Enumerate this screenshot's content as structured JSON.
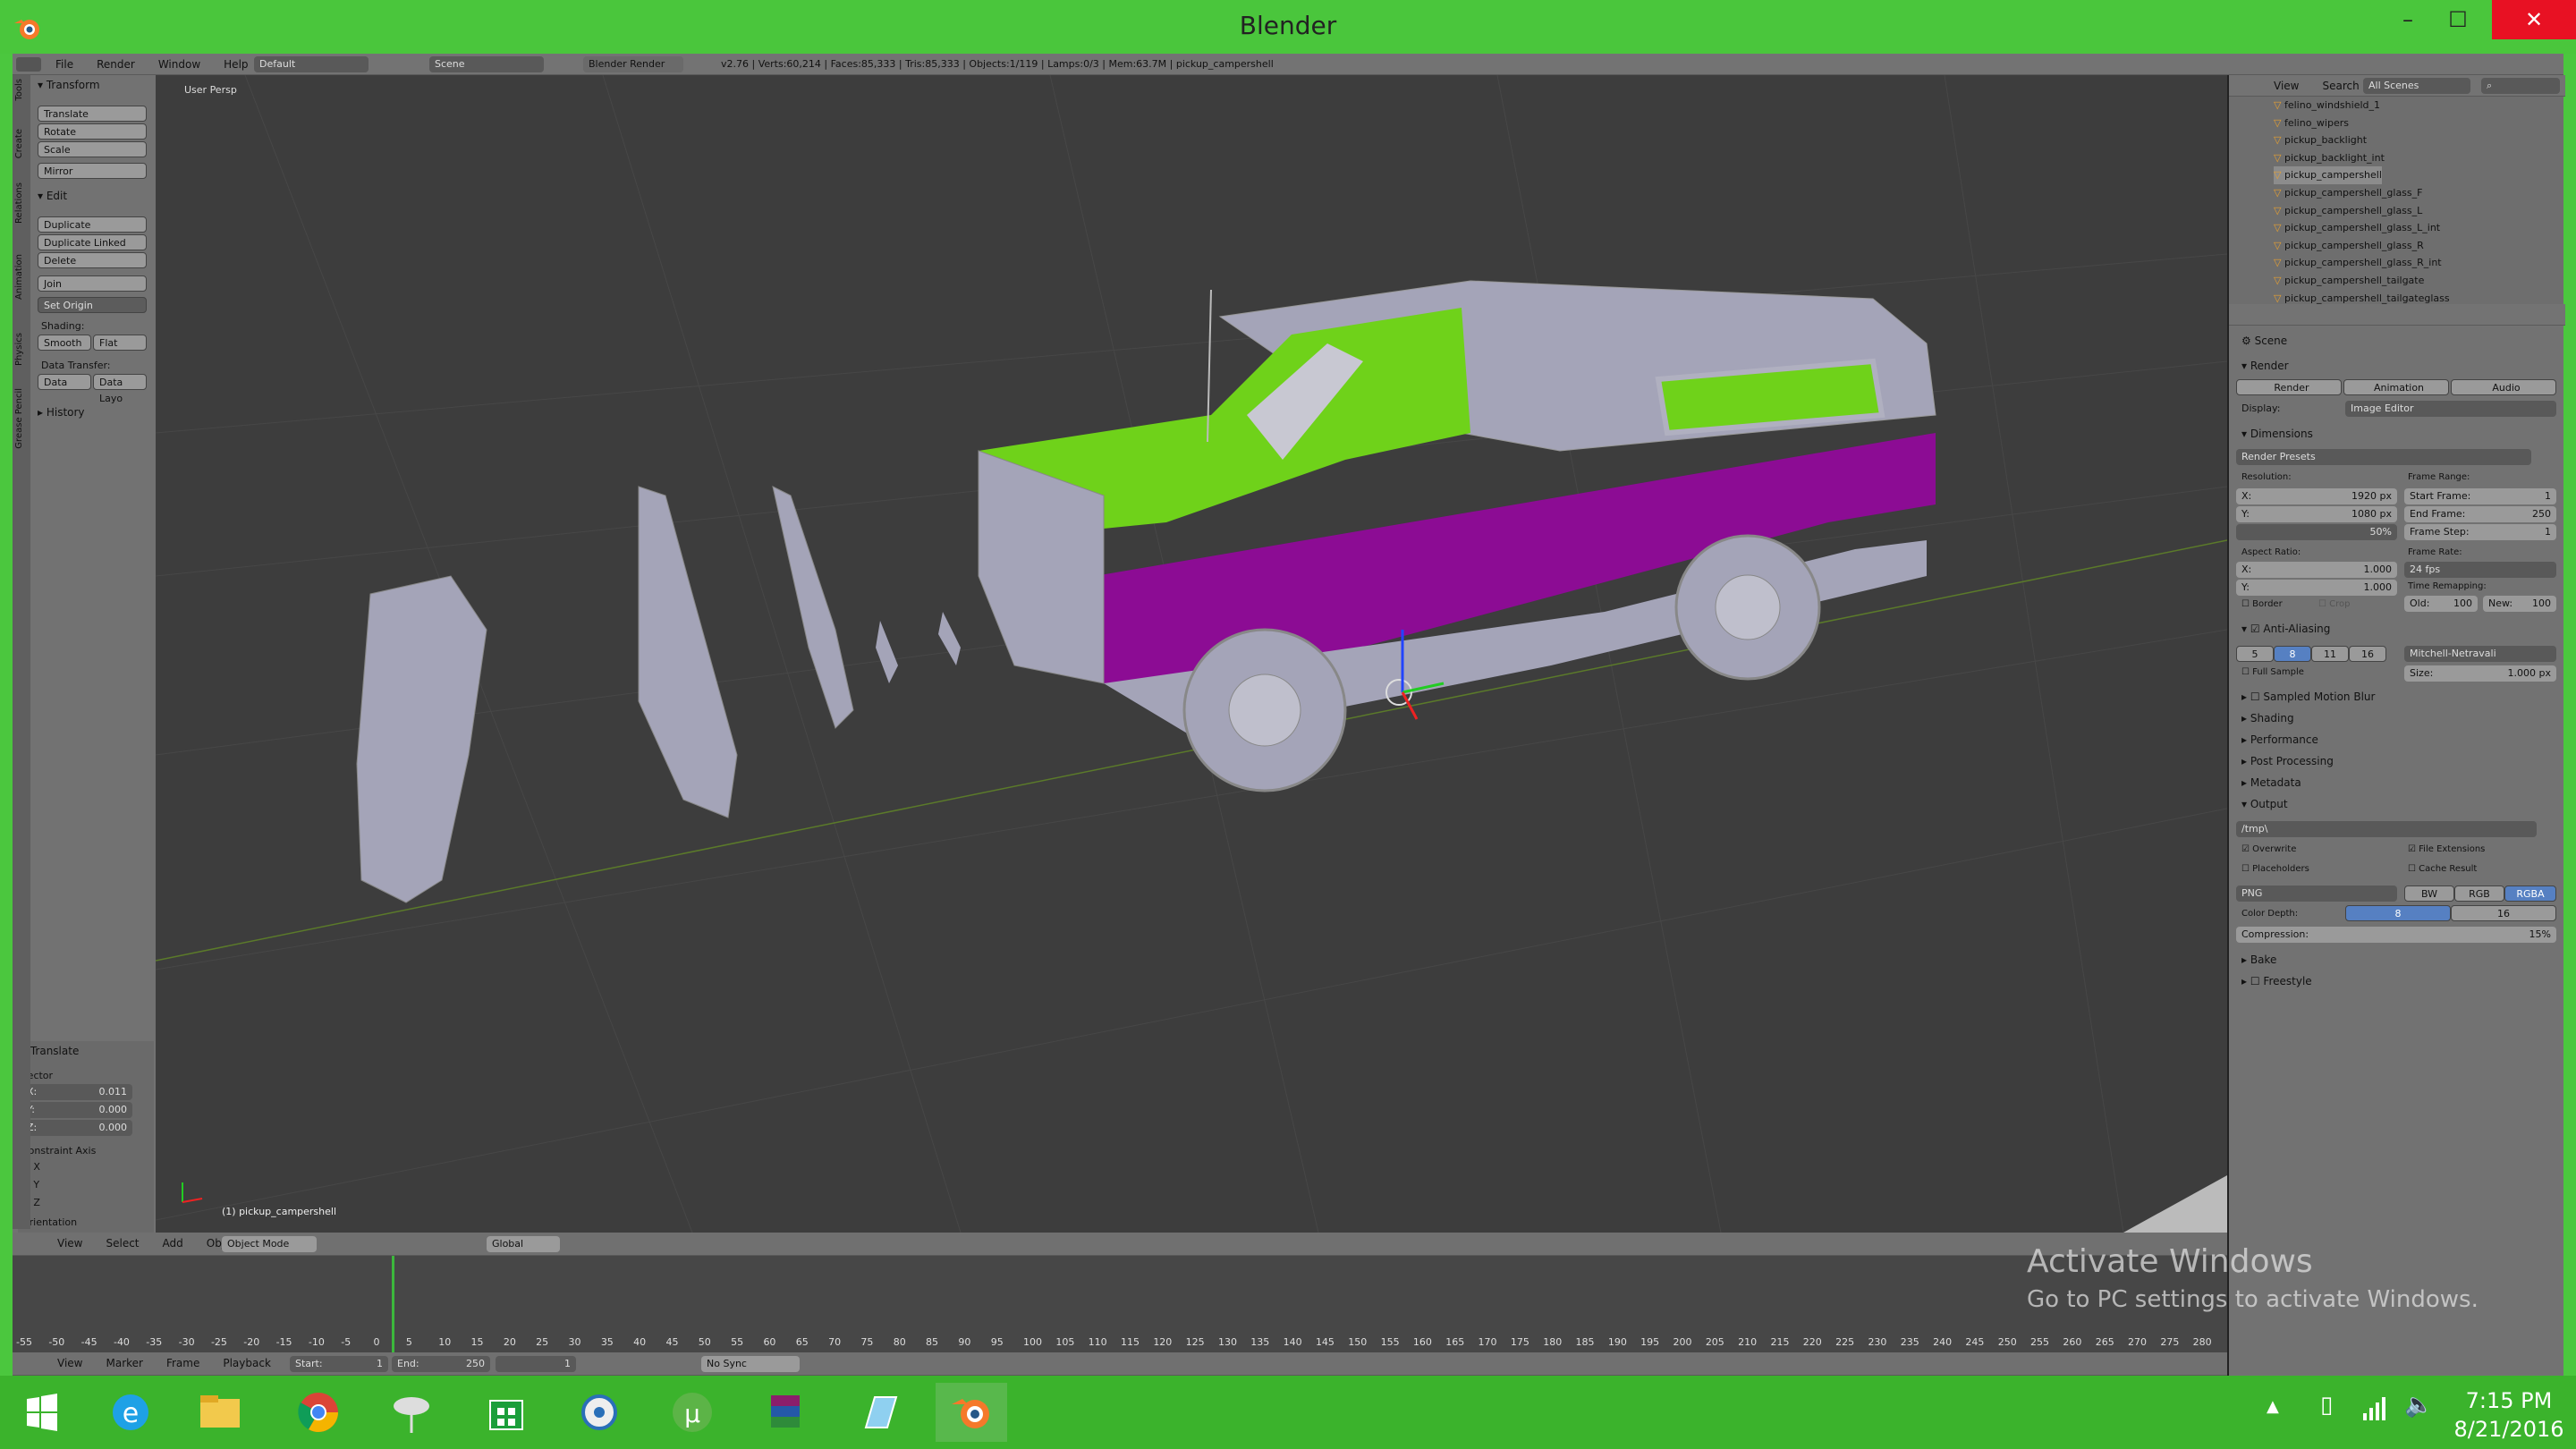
{
  "window": {
    "title": "Blender",
    "min_glyph": "–",
    "max_glyph": "☐",
    "close_glyph": "✕"
  },
  "info_header": {
    "menus": [
      "File",
      "Render",
      "Window",
      "Help"
    ],
    "layout": "Default",
    "scene": "Scene",
    "engine": "Blender Render",
    "stats": "v2.76 | Verts:60,214 | Faces:85,333 | Tris:85,333 | Objects:1/119 | Lamps:0/3 | Mem:63.7M | pickup_campershell"
  },
  "toolshelf": {
    "tabs": [
      "Tools",
      "Create",
      "Relations",
      "Animation",
      "Physics",
      "Grease Pencil"
    ],
    "transform_header": "Transform",
    "transform": [
      "Translate",
      "Rotate",
      "Scale",
      "Mirror"
    ],
    "edit_header": "Edit",
    "edit": [
      "Duplicate",
      "Duplicate Linked",
      "Delete",
      "Join",
      "Set Origin"
    ],
    "shading_label": "Shading:",
    "shading": [
      "Smooth",
      "Flat"
    ],
    "data_transfer_label": "Data Transfer:",
    "data_transfer": [
      "Data",
      "Data Layo"
    ],
    "history": "History",
    "operator": {
      "title": "Translate",
      "vector_label": "Vector",
      "x": "0.011",
      "y": "0.000",
      "z": "0.000",
      "constraint_label": "Constraint Axis",
      "axes": [
        "X",
        "Y",
        "Z"
      ],
      "orientation_label": "Orientation"
    }
  },
  "viewport": {
    "view_label": "User Persp",
    "object_label": "(1) pickup_campershell",
    "colors": {
      "body_green": "#6fd21a",
      "purple": "#8c0c94",
      "gray": "#a4a4b8"
    }
  },
  "viewport_header": {
    "menus": [
      "View",
      "Select",
      "Add",
      "Object"
    ],
    "mode": "Object Mode",
    "orientation": "Global"
  },
  "timeline": {
    "ticks": [
      "-55",
      "-50",
      "-45",
      "-40",
      "-35",
      "-30",
      "-25",
      "-20",
      "-15",
      "-10",
      "-5",
      "0",
      "5",
      "10",
      "15",
      "20",
      "25",
      "30",
      "35",
      "40",
      "45",
      "50",
      "55",
      "60",
      "65",
      "70",
      "75",
      "80",
      "85",
      "90",
      "95",
      "100",
      "105",
      "110",
      "115",
      "120",
      "125",
      "130",
      "135",
      "140",
      "145",
      "150",
      "155",
      "160",
      "165",
      "170",
      "175",
      "180",
      "185",
      "190",
      "195",
      "200",
      "205",
      "210",
      "215",
      "220",
      "225",
      "230",
      "235",
      "240",
      "245",
      "250",
      "255",
      "260",
      "265",
      "270",
      "275",
      "280"
    ],
    "menus": [
      "View",
      "Marker",
      "Frame",
      "Playback"
    ],
    "start": "Start:",
    "start_val": "1",
    "end": "End:",
    "end_val": "250",
    "current": "1",
    "sync": "No Sync"
  },
  "outliner": {
    "menus": [
      "View",
      "Search"
    ],
    "scenes": "All Scenes",
    "items": [
      "felino_windshield_1",
      "felino_wipers",
      "pickup_backlight",
      "pickup_backlight_int",
      "pickup_campershell",
      "pickup_campershell_glass_F",
      "pickup_campershell_glass_L",
      "pickup_campershell_glass_L_int",
      "pickup_campershell_glass_R",
      "pickup_campershell_glass_R_int",
      "pickup_campershell_tailgate",
      "pickup_campershell_tailgateglass"
    ]
  },
  "properties": {
    "scene": "Scene",
    "render_header": "Render",
    "render_btns": [
      "Render",
      "Animation",
      "Audio"
    ],
    "display_label": "Display:",
    "display": "Image Editor",
    "dimensions_header": "Dimensions",
    "presets": "Render Presets",
    "resolution_label": "Resolution:",
    "res_x": "X:",
    "res_x_val": "1920 px",
    "res_y": "Y:",
    "res_y_val": "1080 px",
    "res_pct": "50%",
    "frame_range_label": "Frame Range:",
    "start_frame": "Start Frame:",
    "start_frame_val": "1",
    "end_frame": "End Frame:",
    "end_frame_val": "250",
    "frame_step": "Frame Step:",
    "frame_step_val": "1",
    "aspect_label": "Aspect Ratio:",
    "asp_x": "X:",
    "asp_x_val": "1.000",
    "asp_y": "Y:",
    "asp_y_val": "1.000",
    "frame_rate_label": "Frame Rate:",
    "fps": "24 fps",
    "time_remap_label": "Time Remapping:",
    "old": "Old:",
    "old_val": "100",
    "new": "New:",
    "new_val": "100",
    "border": "Border",
    "crop": "Crop",
    "aa_header": "Anti-Aliasing",
    "aa_samples": [
      "5",
      "8",
      "11",
      "16"
    ],
    "aa_filter": "Mitchell-Netravali",
    "full_sample": "Full Sample",
    "size": "Size:",
    "size_val": "1.000 px",
    "collapsed": [
      "Sampled Motion Blur",
      "Shading",
      "Performance",
      "Post Processing",
      "Metadata"
    ],
    "output_header": "Output",
    "output_path": "/tmp\\",
    "overwrite": "Overwrite",
    "file_ext": "File Extensions",
    "placeholders": "Placeholders",
    "cache": "Cache Result",
    "format": "PNG",
    "color_modes": [
      "BW",
      "RGB",
      "RGBA"
    ],
    "color_depth_label": "Color Depth:",
    "depths": [
      "8",
      "16"
    ],
    "compression": "Compression:",
    "compression_val": "15%",
    "bake": "Bake",
    "freestyle": "Freestyle"
  },
  "watermark": {
    "line1": "Activate Windows",
    "line2": "Go to PC settings to activate Windows."
  },
  "taskbar": {
    "time": "7:15 PM",
    "date": "8/21/2016",
    "apps": [
      "windows-start",
      "internet-explorer",
      "file-explorer",
      "chrome",
      "network-app",
      "store",
      "bittorrent-like",
      "utorrent",
      "winrar",
      "notepad-app",
      "blender"
    ]
  }
}
